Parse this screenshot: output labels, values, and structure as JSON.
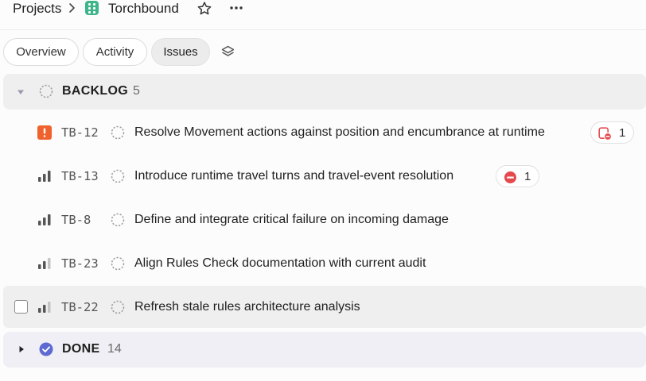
{
  "breadcrumb": {
    "projects_label": "Projects",
    "project_name": "Torchbound"
  },
  "tabs": [
    {
      "label": "Overview",
      "active": false
    },
    {
      "label": "Activity",
      "active": false
    },
    {
      "label": "Issues",
      "active": true
    }
  ],
  "groups": {
    "backlog": {
      "title": "BACKLOG",
      "count": "5",
      "expanded": true,
      "issues": [
        {
          "id": "TB-12",
          "priority": "urgent",
          "title": "Resolve Movement actions against position and encumbrance at runtime",
          "badge_count": "1",
          "badge_icon": "blocked-by-icon"
        },
        {
          "id": "TB-13",
          "priority": "high",
          "title": "Introduce runtime travel turns and travel-event resolution",
          "badge_count": "1",
          "badge_icon": "blocking-icon"
        },
        {
          "id": "TB-8",
          "priority": "high",
          "title": "Define and integrate critical failure on incoming damage"
        },
        {
          "id": "TB-23",
          "priority": "medium",
          "title": "Align Rules Check documentation with current audit"
        },
        {
          "id": "TB-22",
          "priority": "medium",
          "title": "Refresh stale rules architecture analysis",
          "checkbox_visible": true
        }
      ]
    },
    "done": {
      "title": "DONE",
      "count": "14",
      "expanded": false
    }
  },
  "colors": {
    "project_icon": "#3fb58a",
    "urgent": "#f0622d",
    "blocked": "#e5484d",
    "done": "#5e6ad2"
  }
}
